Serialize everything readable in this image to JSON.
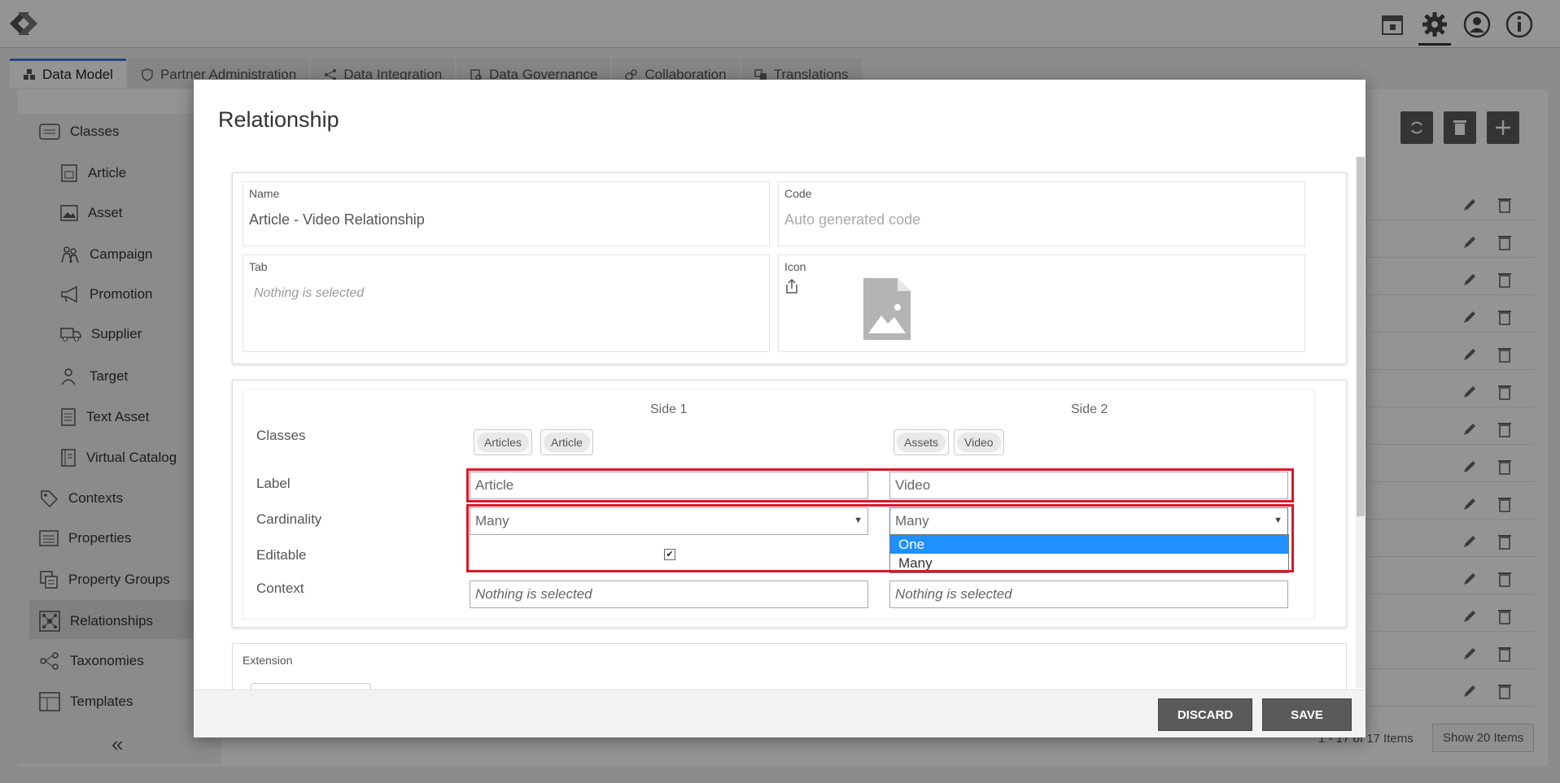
{
  "tabs": [
    {
      "label": "Data Model",
      "icon": "cubes-icon"
    },
    {
      "label": "Partner Administration",
      "icon": "shield-icon"
    },
    {
      "label": "Data Integration",
      "icon": "share-icon"
    },
    {
      "label": "Data Governance",
      "icon": "governance-icon"
    },
    {
      "label": "Collaboration",
      "icon": "gears-icon"
    },
    {
      "label": "Translations",
      "icon": "translate-icon"
    }
  ],
  "sidebar": {
    "items": [
      {
        "label": "Classes"
      },
      {
        "label": "Article"
      },
      {
        "label": "Asset"
      },
      {
        "label": "Campaign"
      },
      {
        "label": "Promotion"
      },
      {
        "label": "Supplier"
      },
      {
        "label": "Target"
      },
      {
        "label": "Text Asset"
      },
      {
        "label": "Virtual Catalog"
      },
      {
        "label": "Contexts"
      },
      {
        "label": "Properties"
      },
      {
        "label": "Property Groups"
      },
      {
        "label": "Relationships"
      },
      {
        "label": "Taxonomies"
      },
      {
        "label": "Templates"
      }
    ],
    "collapse": "«"
  },
  "background_footer": {
    "pagination": "1 - 17 of 17 Items",
    "show_items": "Show 20 Items"
  },
  "modal": {
    "title": "Relationship",
    "name_label": "Name",
    "name_value": "Article - Video Relationship",
    "code_label": "Code",
    "code_placeholder": "Auto generated code",
    "tab_label": "Tab",
    "tab_placeholder": "Nothing is selected",
    "icon_label": "Icon",
    "side1_header": "Side 1",
    "side2_header": "Side 2",
    "classes_label": "Classes",
    "label_label": "Label",
    "cardinality_label": "Cardinality",
    "editable_label": "Editable",
    "context_label": "Context",
    "side1_chips": [
      "Articles",
      "Article"
    ],
    "side2_chips": [
      "Assets",
      "Video"
    ],
    "side1_label_value": "Article",
    "side2_label_value": "Video",
    "side1_cardinality": "Many",
    "side2_cardinality": "Many",
    "dropdown_options": [
      "One",
      "Many"
    ],
    "dropdown_highlighted": "One",
    "editable_checked": true,
    "side1_context_placeholder": "Nothing is selected",
    "side2_context_placeholder": "Nothing is selected",
    "extension_label": "Extension",
    "discard_label": "DISCARD",
    "save_label": "SAVE"
  },
  "colors": {
    "highlight_border": "#d7182a",
    "dropdown_selected": "#1e90ff",
    "active_tab_accent": "#3b7dd8"
  }
}
